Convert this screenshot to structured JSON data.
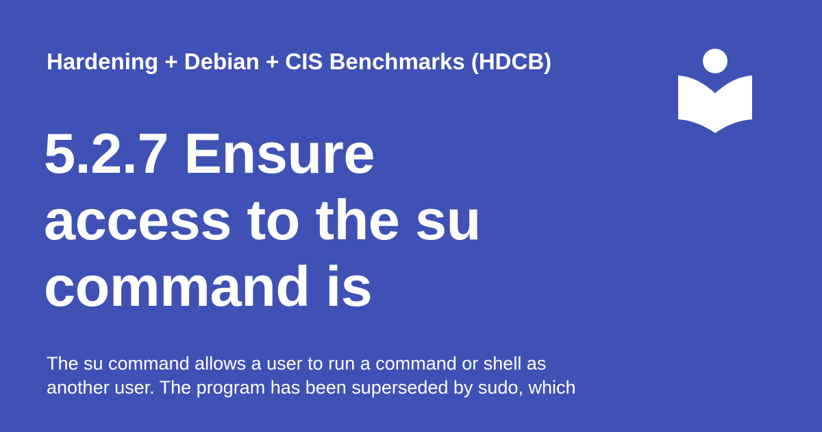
{
  "site": {
    "name": "Hardening + Debian + CIS Benchmarks (HDCB)",
    "logo_icon": "book-reader-icon"
  },
  "title": {
    "lines": [
      "5.2.7 Ensure",
      "access to the su",
      "command is"
    ]
  },
  "description": {
    "lines": [
      "The su command allows a user to run a command or shell as",
      "another user. The program has been superseded by sudo, which"
    ]
  },
  "colors": {
    "background": "#3f51b5",
    "foreground": "#ffffff"
  }
}
